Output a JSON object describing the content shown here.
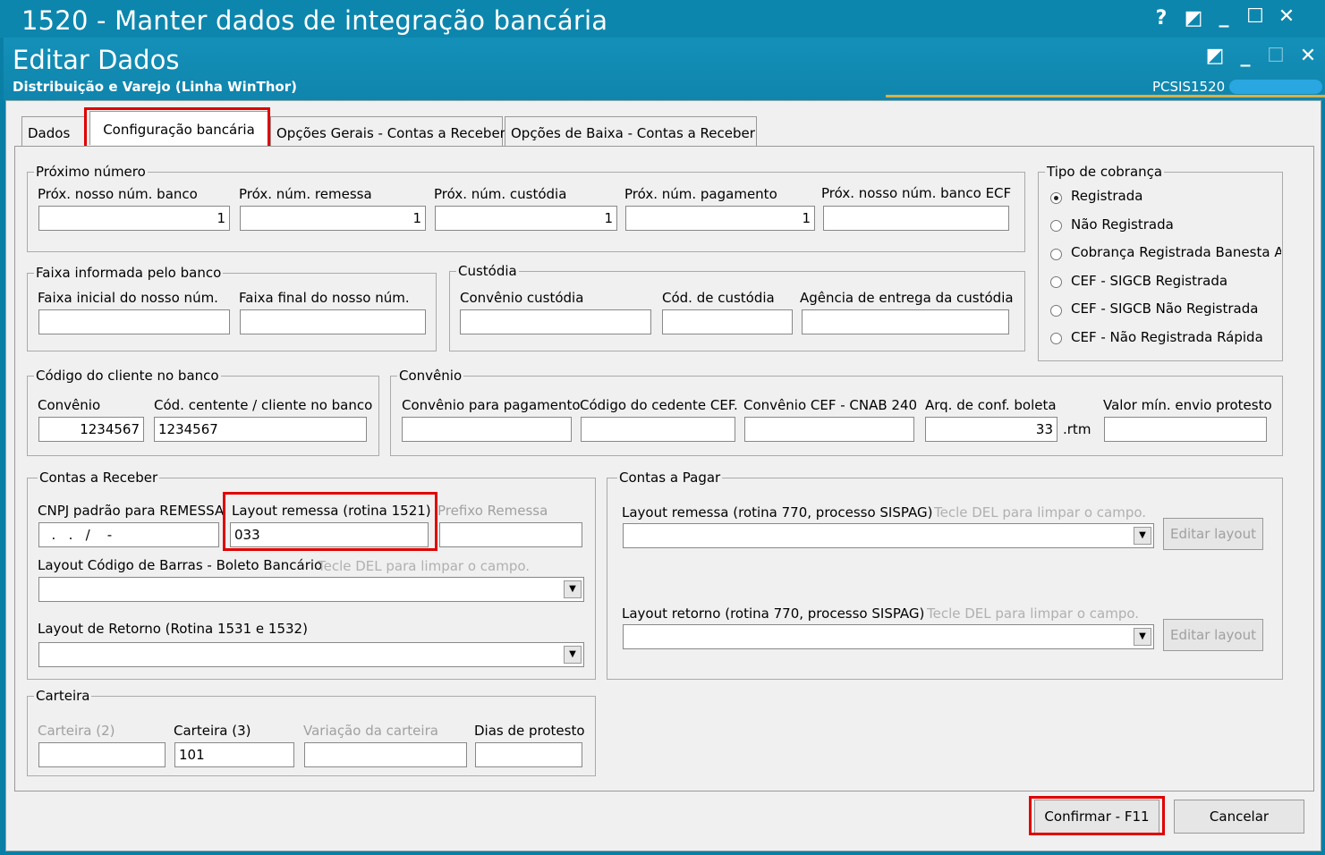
{
  "window": {
    "outer_title": "1520 - Manter dados de integração bancária",
    "inner_title": "Editar Dados",
    "subtitle": "Distribuição e Varejo (Linha WinThor)",
    "routine_code": "PCSIS1520",
    "outer_icons": [
      "?",
      "◩",
      "_",
      "☐",
      "✕"
    ],
    "inner_icons": [
      "◩",
      "_",
      "☐",
      "✕"
    ]
  },
  "tabs": [
    {
      "label": "Dados"
    },
    {
      "label": "Configuração bancária"
    },
    {
      "label": "Opções Gerais - Contas a Receber"
    },
    {
      "label": "Opções de Baixa - Contas a Receber"
    }
  ],
  "proximo_numero": {
    "title": "Próximo número",
    "fields": [
      {
        "label": "Próx. nosso núm. banco",
        "value": "1"
      },
      {
        "label": "Próx. núm. remessa",
        "value": "1"
      },
      {
        "label": "Próx. núm. custódia",
        "value": "1"
      },
      {
        "label": "Próx. núm. pagamento",
        "value": "1"
      },
      {
        "label": "Próx. nosso núm. banco ECF",
        "value": ""
      }
    ]
  },
  "tipo_cobranca": {
    "title": "Tipo de cobrança",
    "options": [
      "Registrada",
      "Não Registrada",
      "Cobrança Registrada Banesta Ar",
      "CEF - SIGCB Registrada",
      "CEF - SIGCB Não Registrada",
      "CEF - Não Registrada Rápida"
    ],
    "selected": 0
  },
  "faixa": {
    "title": "Faixa informada pelo banco",
    "inicial_label": "Faixa inicial do nosso núm.",
    "final_label": "Faixa final do nosso núm."
  },
  "custodia": {
    "title": "Custódia",
    "convenio_label": "Convênio custódia",
    "cod_label": "Cód. de custódia",
    "agencia_label": "Agência de entrega da custódia"
  },
  "codigo_cliente": {
    "title": "Código do cliente no banco",
    "convenio_label": "Convênio",
    "convenio_value": "1234567",
    "cedente_label": "Cód. centente / cliente no banco",
    "cedente_value": "1234567"
  },
  "convenio": {
    "title": "Convênio",
    "pagamento_label": "Convênio para pagamento",
    "cedente_cef_label": "Código do cedente CEF.",
    "cnab_label": "Convênio CEF - CNAB 240",
    "boleta_label": "Arq. de conf. boleta",
    "boleta_value": "33",
    "boleta_ext": ".rtm",
    "protesto_label": "Valor mín. envio protesto"
  },
  "contas_receber": {
    "title": "Contas a Receber",
    "cnpj_label": "CNPJ padrão para REMESSA",
    "cnpj_value": "  .   .   /    -",
    "layout_remessa_label": "Layout remessa (rotina 1521)",
    "layout_remessa_value": "033",
    "prefixo_label": "Prefixo Remessa",
    "barras_label": "Layout Código de Barras - Boleto Bancário",
    "barras_hint": "Tecle DEL para limpar o campo.",
    "retorno_label": "Layout  de Retorno (Rotina 1531 e 1532)"
  },
  "contas_pagar": {
    "title": "Contas a Pagar",
    "remessa_label": "Layout remessa (rotina 770, processo SISPAG)",
    "remessa_hint": "Tecle DEL para limpar o campo.",
    "retorno_label": "Layout retorno (rotina 770, processo SISPAG)",
    "retorno_hint": "Tecle DEL para limpar o campo.",
    "edit_button": "Editar layout"
  },
  "carteira": {
    "title": "Carteira",
    "carteira2_label": "Carteira (2)",
    "carteira3_label": "Carteira (3)",
    "carteira3_value": "101",
    "variacao_label": "Variação da carteira",
    "dias_label": "Dias de protesto"
  },
  "buttons": {
    "confirm": "Confirmar - F11",
    "cancel": "Cancelar"
  }
}
